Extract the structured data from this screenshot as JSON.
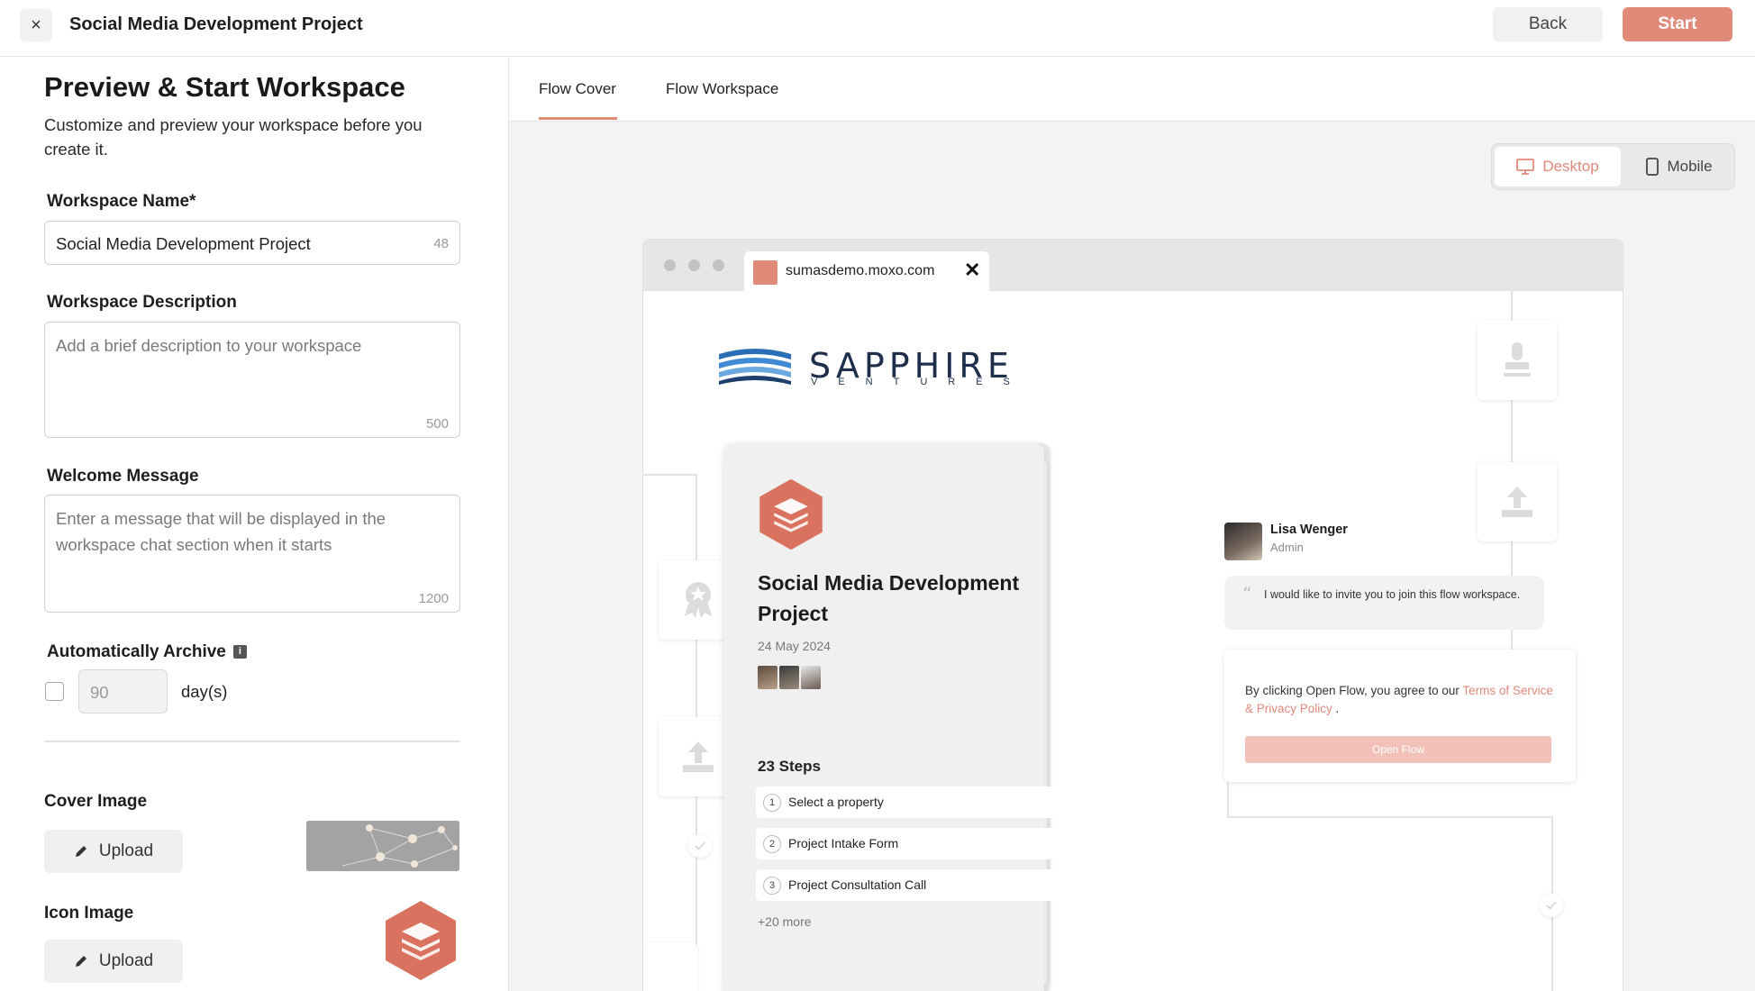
{
  "header": {
    "close_icon": "close-icon",
    "title": "Social Media Development Project",
    "back_label": "Back",
    "start_label": "Start",
    "accent_color": "#e08a7a"
  },
  "form": {
    "title": "Preview & Start Workspace",
    "subtitle": "Customize and preview your workspace before you create it.",
    "name": {
      "label": "Workspace Name*",
      "value": "Social Media Development Project",
      "counter": "48"
    },
    "description": {
      "label": "Workspace Description",
      "placeholder": "Add a brief description to your workspace",
      "counter": "500"
    },
    "welcome": {
      "label": "Welcome Message",
      "placeholder": "Enter a message that will be displayed in the workspace chat section when it starts",
      "counter": "1200"
    },
    "archive": {
      "label": "Automatically Archive",
      "info_icon": "i",
      "checked": false,
      "days_value": "90",
      "days_unit": "day(s)"
    },
    "cover_image": {
      "label": "Cover Image",
      "upload_label": "Upload"
    },
    "icon_image": {
      "label": "Icon Image",
      "upload_label": "Upload"
    }
  },
  "preview": {
    "tabs": [
      {
        "label": "Flow Cover",
        "active": true
      },
      {
        "label": "Flow Workspace",
        "active": false
      }
    ],
    "view_toggle": {
      "desktop_label": "Desktop",
      "mobile_label": "Mobile",
      "selected": "Desktop"
    },
    "browser": {
      "tab_url": "sumasdemo.moxo.com",
      "tab_close": "✕"
    },
    "logo": {
      "name": "SAPPHIRE",
      "sub": "VENTURES"
    },
    "cover_card": {
      "title": "Social Media Development Project",
      "date": "24 May 2024",
      "steps_label": "23 Steps",
      "steps": [
        {
          "num": "1",
          "label": "Select a property"
        },
        {
          "num": "2",
          "label": "Project Intake Form"
        },
        {
          "num": "3",
          "label": "Project Consultation Call"
        }
      ],
      "more_label": "+20 more"
    },
    "invite": {
      "name": "Lisa Wenger",
      "role": "Admin",
      "quote_mark": "“",
      "message": "I would like to invite you to join this flow workspace.",
      "terms_prefix": "By clicking Open Flow, you agree to our ",
      "terms_link": "Terms of Service & Privacy Policy",
      "terms_suffix": " .",
      "open_flow_label": "Open Flow"
    }
  }
}
